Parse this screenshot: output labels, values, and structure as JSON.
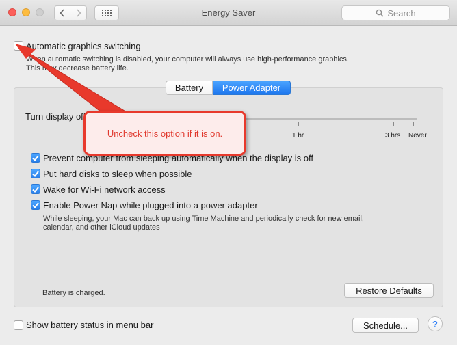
{
  "window": {
    "title": "Energy Saver",
    "search_placeholder": "Search"
  },
  "graphics": {
    "label": "Automatic graphics switching",
    "checked": false,
    "description_line1": "When automatic switching is disabled, your computer will always use high-performance graphics.",
    "description_line2": "This may decrease battery life."
  },
  "tabs": [
    {
      "label": "Battery",
      "active": false
    },
    {
      "label": "Power Adapter",
      "active": true
    }
  ],
  "display_sleep": {
    "label": "Turn display off after:",
    "ticks": [
      "1 hr",
      "3 hrs",
      "Never"
    ]
  },
  "options": [
    {
      "label": "Prevent computer from sleeping automatically when the display is off",
      "checked": true
    },
    {
      "label": "Put hard disks to sleep when possible",
      "checked": true
    },
    {
      "label": "Wake for Wi-Fi network access",
      "checked": true
    },
    {
      "label": "Enable Power Nap while plugged into a power adapter",
      "checked": true
    }
  ],
  "powernap_description_line1": "While sleeping, your Mac can back up using Time Machine and periodically check for new email,",
  "powernap_description_line2": "calendar, and other iCloud updates",
  "status_text": "Battery is charged.",
  "restore_defaults_label": "Restore Defaults",
  "show_battery_status": {
    "label": "Show battery status in menu bar",
    "checked": false
  },
  "schedule_label": "Schedule...",
  "help_label": "?",
  "annotation": {
    "text": "Uncheck this option if it is on.",
    "color": "#e8392c"
  }
}
